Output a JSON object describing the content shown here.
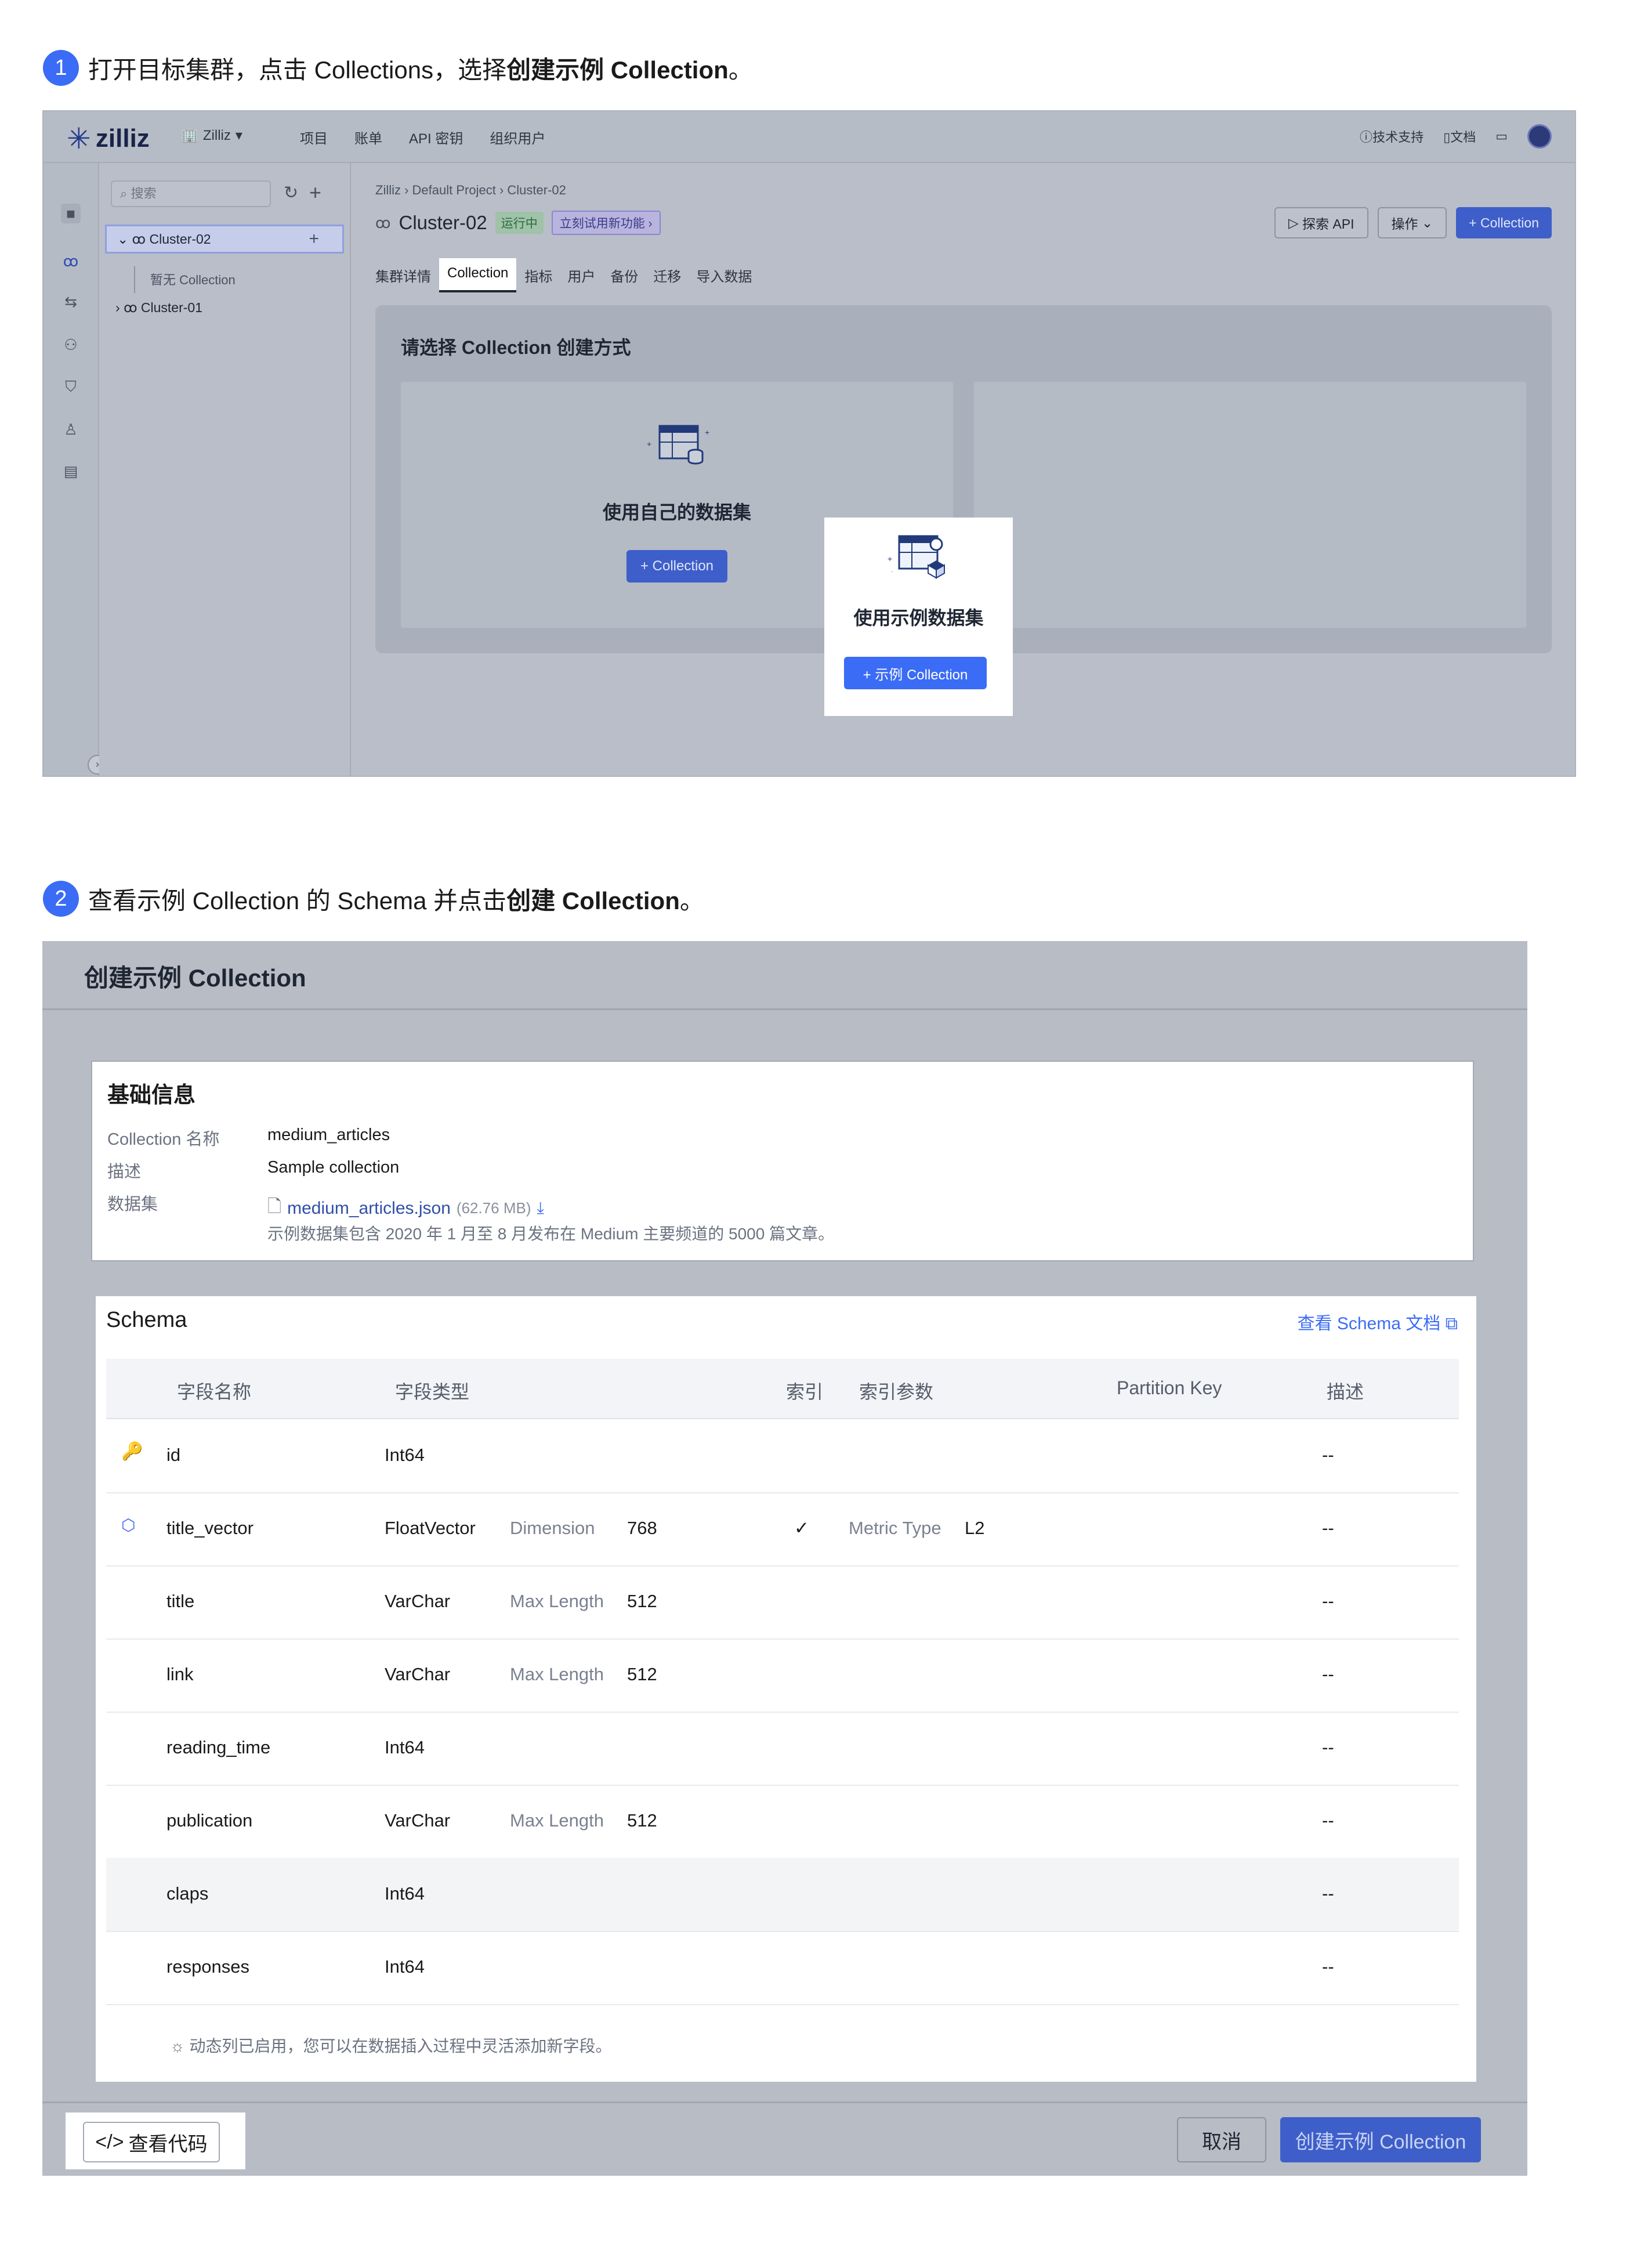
{
  "step1": {
    "num": "1",
    "text_pre": "打开目标集群，点击 Collections，选择",
    "text_bold": "创建示例 Collection",
    "text_post": "。"
  },
  "step2": {
    "num": "2",
    "text_pre": "查看示例 Collection 的 Schema 并点击",
    "text_bold": "创建 Collection",
    "text_post": "。"
  },
  "shot1": {
    "logo": "zilliz",
    "org": "Zilliz",
    "nav": [
      "项目",
      "账单",
      "API 密钥",
      "组织用户"
    ],
    "topright": {
      "support": "技术支持",
      "docs": "文档"
    },
    "search_placeholder": "搜索",
    "tree": {
      "cluster_selected": "Cluster-02",
      "empty_leaf": "暂无 Collection",
      "cluster_other": "Cluster-01"
    },
    "breadcrumb": "Zilliz › Default Project › Cluster-02",
    "cluster_title": "Cluster-02",
    "status_badge": "运行中",
    "try_badge": "立刻试用新功能 ›",
    "actions": {
      "explore": "探索 API",
      "ops": "操作",
      "add": "+ Collection"
    },
    "tabs": [
      "集群详情",
      "Collection",
      "指标",
      "用户",
      "备份",
      "迁移",
      "导入数据"
    ],
    "panel_title": "请选择 Collection 创建方式",
    "own": {
      "title": "使用自己的数据集",
      "button": "+ Collection"
    },
    "sample": {
      "title": "使用示例数据集",
      "button": "+ 示例 Collection"
    }
  },
  "shot2": {
    "dialog_title": "创建示例 Collection",
    "basic": {
      "heading": "基础信息",
      "name_label": "Collection 名称",
      "name_value": "medium_articles",
      "desc_label": "描述",
      "desc_value": "Sample collection",
      "dataset_label": "数据集",
      "file_name": "medium_articles.json",
      "file_size": "(62.76 MB)",
      "note": "示例数据集包含 2020 年 1 月至 8 月发布在 Medium 主要频道的 5000 篇文章。"
    },
    "schema": {
      "heading": "Schema",
      "doc_link": "查看 Schema 文档",
      "columns": [
        "字段名称",
        "字段类型",
        "索引",
        "索引参数",
        "Partition Key",
        "描述"
      ],
      "rows": [
        {
          "name": "id",
          "type": "Int64",
          "param_label": "",
          "param_value": "",
          "index": "",
          "metric_label": "",
          "metric_value": "",
          "desc": "--"
        },
        {
          "name": "title_vector",
          "type": "FloatVector",
          "param_label": "Dimension",
          "param_value": "768",
          "index": "✓",
          "metric_label": "Metric Type",
          "metric_value": "L2",
          "desc": "--"
        },
        {
          "name": "title",
          "type": "VarChar",
          "param_label": "Max Length",
          "param_value": "512",
          "index": "",
          "metric_label": "",
          "metric_value": "",
          "desc": "--"
        },
        {
          "name": "link",
          "type": "VarChar",
          "param_label": "Max Length",
          "param_value": "512",
          "index": "",
          "metric_label": "",
          "metric_value": "",
          "desc": "--"
        },
        {
          "name": "reading_time",
          "type": "Int64",
          "param_label": "",
          "param_value": "",
          "index": "",
          "metric_label": "",
          "metric_value": "",
          "desc": "--"
        },
        {
          "name": "publication",
          "type": "VarChar",
          "param_label": "Max Length",
          "param_value": "512",
          "index": "",
          "metric_label": "",
          "metric_value": "",
          "desc": "--"
        },
        {
          "name": "claps",
          "type": "Int64",
          "param_label": "",
          "param_value": "",
          "index": "",
          "metric_label": "",
          "metric_value": "",
          "desc": "--"
        },
        {
          "name": "responses",
          "type": "Int64",
          "param_label": "",
          "param_value": "",
          "index": "",
          "metric_label": "",
          "metric_value": "",
          "desc": "--"
        }
      ],
      "dynamic_note": "动态列已启用，您可以在数据插入过程中灵活添加新字段。"
    },
    "footer": {
      "view_code": "查看代码",
      "cancel": "取消",
      "create": "创建示例 Collection"
    }
  }
}
